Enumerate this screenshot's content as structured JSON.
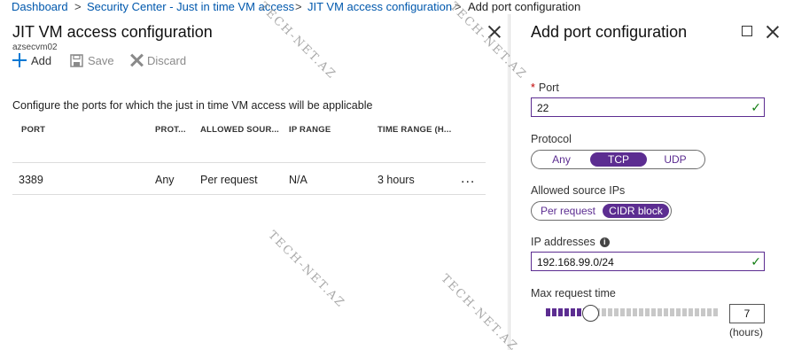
{
  "breadcrumb": {
    "items": [
      "Dashboard",
      "Security Center - Just in time VM access",
      "JIT VM access configuration"
    ],
    "current": "Add port configuration",
    "separator": ">"
  },
  "left_blade": {
    "title": "JIT VM access configuration",
    "subtitle": "azsecvm02",
    "toolbar": {
      "add_label": "Add",
      "save_label": "Save",
      "discard_label": "Discard"
    },
    "description": "Configure the ports for which the just in time VM access will be applicable",
    "table": {
      "columns": [
        "PORT",
        "PROT...",
        "ALLOWED SOUR...",
        "IP RANGE",
        "TIME RANGE (H..."
      ],
      "rows": [
        {
          "port": "3389",
          "protocol": "Any",
          "allowed_source": "Per request",
          "ip_range": "N/A",
          "time_range": "3 hours",
          "more": "..."
        }
      ]
    }
  },
  "right_blade": {
    "title": "Add port configuration",
    "port": {
      "label": "Port",
      "required_mark": "*",
      "value": "22",
      "valid_icon": "checkmark-icon"
    },
    "protocol": {
      "label": "Protocol",
      "options": [
        "Any",
        "TCP",
        "UDP"
      ],
      "selected": "TCP"
    },
    "allowed_source": {
      "label": "Allowed source IPs",
      "options": [
        "Per request",
        "CIDR block"
      ],
      "selected": "CIDR block"
    },
    "ip_addresses": {
      "label": "IP addresses",
      "info_icon": "info-icon",
      "value": "192.168.99.0/24",
      "valid_icon": "checkmark-icon"
    },
    "max_request_time": {
      "label": "Max request time",
      "value": "7",
      "units": "(hours)",
      "fraction": 0.25
    }
  },
  "watermark": {
    "text": "TECH-NET.AZ"
  },
  "colors": {
    "accent": "#5c2d91",
    "link": "#0058ad",
    "add_icon": "#0078d4",
    "valid": "#107c10",
    "slider_track": "#c8c8c8"
  }
}
